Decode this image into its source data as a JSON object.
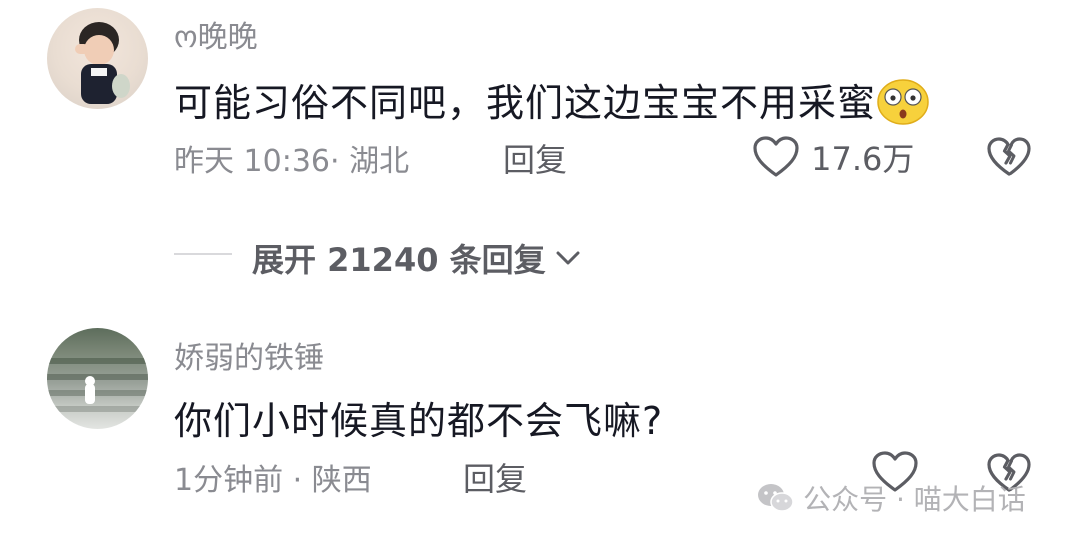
{
  "comments": [
    {
      "username": "ო晚晚",
      "text": "可能习俗不同吧，我们这边宝宝不用采蜜",
      "emoji": "surprised-face-emoji",
      "meta": "昨天 10:36· 湖北",
      "reply_label": "回复",
      "like_count": "17.6万"
    },
    {
      "username": "娇弱的铁锤",
      "text": "你们小时候真的都不会飞嘛?",
      "meta": "1分钟前 · 陕西",
      "reply_label": "回复"
    }
  ],
  "expand_replies": "展开 21240 条回复",
  "watermark": {
    "icon": "wechat-icon",
    "text": "公众号 · 喵大白话"
  },
  "icons": [
    "heart-icon",
    "dislike-broken-heart-icon",
    "chevron-down-icon"
  ]
}
